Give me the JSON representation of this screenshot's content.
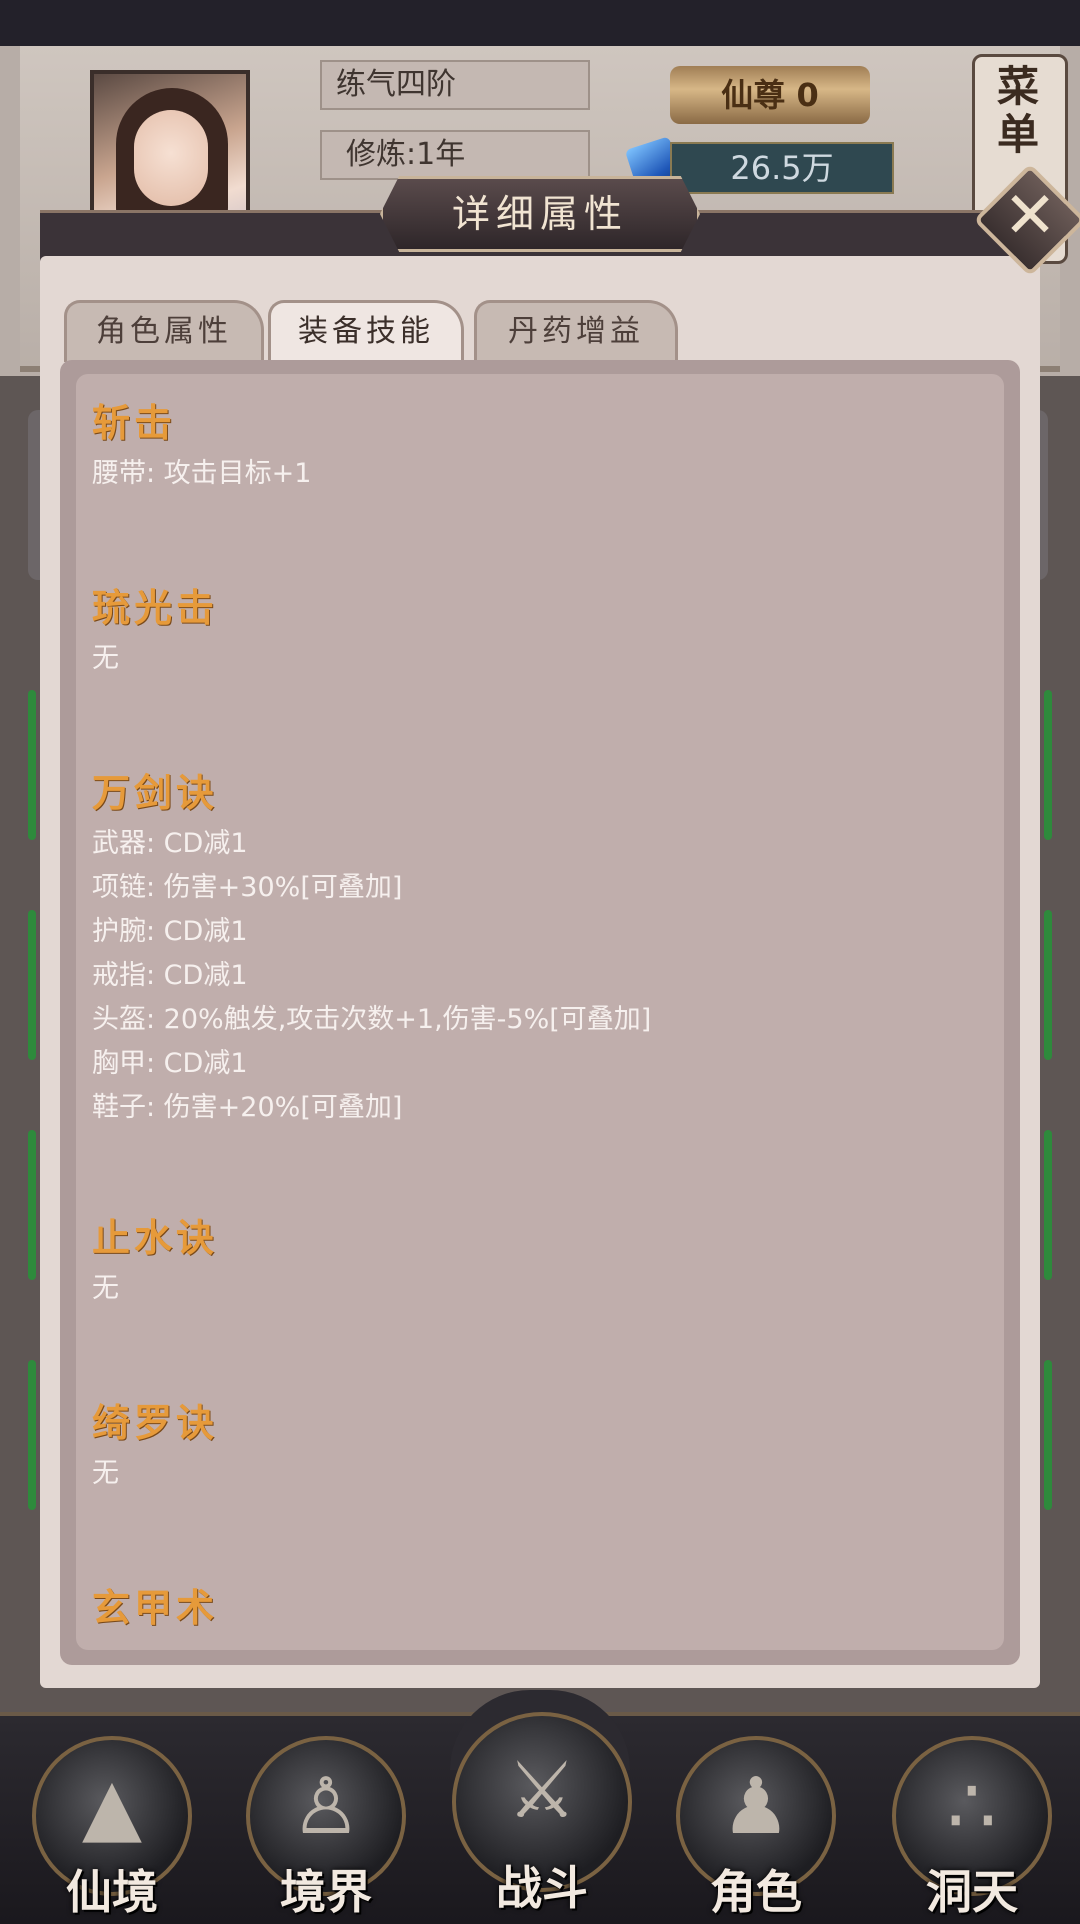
{
  "hud": {
    "realm": "练气四阶",
    "cultivation": "修炼:1年",
    "rank_label": "仙尊",
    "rank_value": "0",
    "currency": "26.5万",
    "menu_label": "菜单"
  },
  "modal": {
    "title": "详细属性",
    "tabs": [
      {
        "label": "角色属性"
      },
      {
        "label": "装备技能"
      },
      {
        "label": "丹药增益"
      }
    ],
    "sections": [
      {
        "title": "斩击",
        "lines": [
          "腰带: 攻击目标+1"
        ]
      },
      {
        "title": "琉光击",
        "lines": [
          "无"
        ]
      },
      {
        "title": "万剑诀",
        "lines": [
          "武器: CD减1",
          "项链: 伤害+30%[可叠加]",
          "护腕: CD减1",
          "戒指: CD减1",
          "头盔: 20%触发,攻击次数+1,伤害-5%[可叠加]",
          "胸甲: CD减1",
          "鞋子: 伤害+20%[可叠加]"
        ]
      },
      {
        "title": "止水诀",
        "lines": [
          "无"
        ]
      },
      {
        "title": "绮罗诀",
        "lines": [
          "无"
        ]
      },
      {
        "title": "玄甲术",
        "lines": []
      }
    ]
  },
  "bottom_nav": [
    {
      "label": "仙境",
      "icon": "mountain-icon"
    },
    {
      "label": "境界",
      "icon": "meditation-icon"
    },
    {
      "label": "战斗",
      "icon": "crossed-swords-icon"
    },
    {
      "label": "角色",
      "icon": "character-icon"
    },
    {
      "label": "洞天",
      "icon": "triple-orb-icon"
    }
  ],
  "colors": {
    "section_title": "#e69a3a",
    "content_bg": "#c0aeac",
    "modal_bg": "#e3d8d3"
  }
}
